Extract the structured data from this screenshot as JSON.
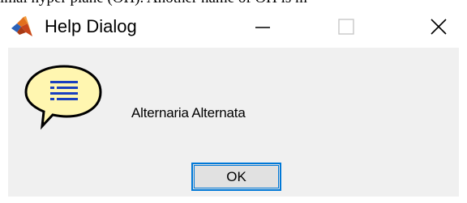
{
  "background_text": "imal hyper plane (OH). Another name of OH is m",
  "window": {
    "title": "Help Dialog",
    "app_icon": "matlab-membrane-icon",
    "controls": {
      "minimize_icon": "minimize-icon",
      "maximize_icon": "maximize-icon",
      "close_icon": "close-icon"
    }
  },
  "dialog": {
    "icon": "help-speech-bubble-icon",
    "message": "Alternaria Alternata",
    "ok_label": "OK"
  },
  "colors": {
    "accent": "#0078d7",
    "client_bg": "#f0f0f0",
    "bubble_fill": "#fff6b0",
    "bubble_lines": "#1a3fbf"
  }
}
